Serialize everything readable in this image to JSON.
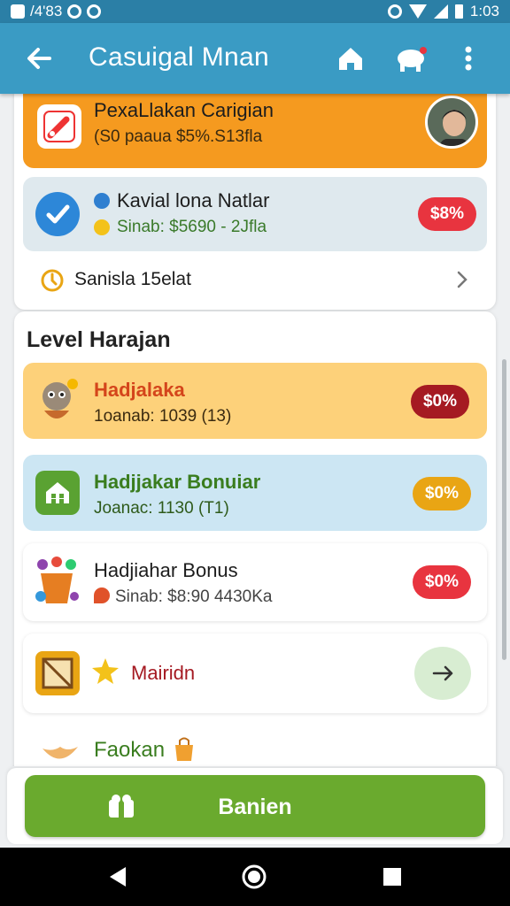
{
  "status_bar": {
    "left_text": "/4'83",
    "time": "1:03"
  },
  "app_bar": {
    "title": "Casuigal Mnan"
  },
  "top_card": {
    "promo": {
      "title": "PexaLlakan Carigian",
      "subtitle": "(S0 paaua $5%.S13fla"
    },
    "task": {
      "title": "Kavial lona Natlar",
      "subtitle": "Sinab: $5690 - 2Jfla",
      "badge": "$8%"
    },
    "link": {
      "label": "Sanisla 15elat"
    }
  },
  "level_card": {
    "section_title": "Level Harajan",
    "items": [
      {
        "title": "Hadjalaka",
        "subtitle": "1oanab: 1039 (13)",
        "badge": "$0%"
      },
      {
        "title": "Hadjjakar Bonuiar",
        "subtitle": "Joanac: 1130 (T1)",
        "badge": "$0%"
      },
      {
        "title": "Hadjiahar Bonus",
        "subtitle": "Sinab: $8:90 4430Ka",
        "badge": "$0%"
      },
      {
        "title": "Mairidn"
      },
      {
        "title": "Faokan"
      }
    ]
  },
  "cta": {
    "label": "Banien"
  },
  "colors": {
    "app_bar": "#3a9bc4",
    "promo_bg": "#f59a1f",
    "task_bg": "#dfe9ee",
    "badge_red": "#e8343f",
    "badge_dark_red": "#a51a22",
    "badge_amber": "#e9a514",
    "cta": "#6aaa2e"
  },
  "icons": [
    "back-arrow-icon",
    "home-icon",
    "pet-icon",
    "more-vert-icon",
    "check-icon",
    "clock-icon",
    "chevron-right-icon",
    "arrow-right-icon"
  ]
}
